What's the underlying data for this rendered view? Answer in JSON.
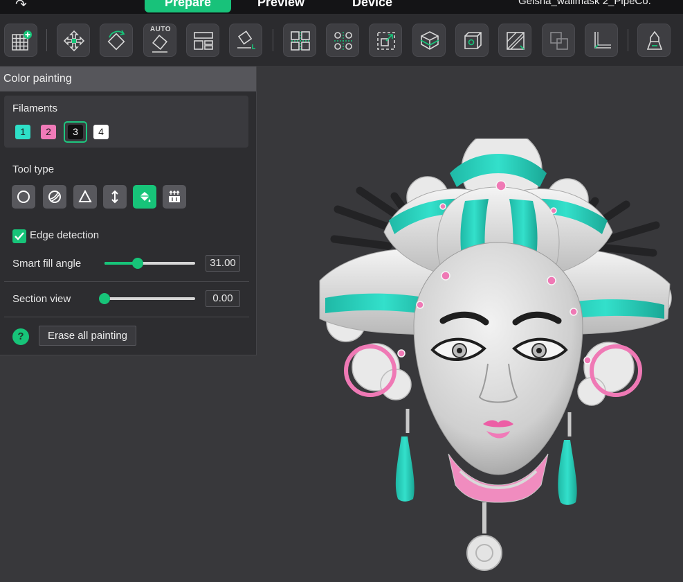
{
  "top_bar": {
    "redo_glyph": "↷",
    "tabs": [
      {
        "label": "Prepare",
        "active": true
      },
      {
        "label": "Preview",
        "active": false
      },
      {
        "label": "Device",
        "active": false
      }
    ],
    "project_title": "Geisha_wallmask 2_PipeCo."
  },
  "toolbar": {
    "auto_label": "AUTO",
    "buttons": [
      "add-plate-icon",
      "arrange-icon",
      "orient-icon",
      "auto-orient-icon",
      "layout-icon",
      "lay-on-face-icon",
      "split-objects-icon",
      "split-parts-icon",
      "bounding-box-icon",
      "slice-plane-icon",
      "cube-icon",
      "support-paint-icon",
      "boolean-icon",
      "measure-icon",
      "color-paint-icon"
    ]
  },
  "panel": {
    "title": "Color painting",
    "filaments_label": "Filaments",
    "filaments": [
      {
        "number": "1",
        "color": "#2ee0c8",
        "text_color": "#1a1a1a"
      },
      {
        "number": "2",
        "color": "#f07ab8",
        "text_color": "#1a1a1a"
      },
      {
        "number": "3",
        "color": "#111111",
        "text_color": "#ffffff",
        "selected": true
      },
      {
        "number": "4",
        "color": "#ffffff",
        "text_color": "#1a1a1a"
      }
    ],
    "tool_type_label": "Tool type",
    "tools": [
      {
        "name": "circle-tool-icon",
        "active": false
      },
      {
        "name": "sphere-tool-icon",
        "active": false
      },
      {
        "name": "triangle-tool-icon",
        "active": false
      },
      {
        "name": "height-range-tool-icon",
        "active": false
      },
      {
        "name": "fill-bucket-tool-icon",
        "active": true
      },
      {
        "name": "gap-fill-tool-icon",
        "active": false
      }
    ],
    "edge_detection_label": "Edge detection",
    "edge_detection_checked": true,
    "smart_fill_label": "Smart fill angle",
    "smart_fill_value": "31.00",
    "smart_fill_fraction": 0.37,
    "section_view_label": "Section view",
    "section_view_value": "0.00",
    "section_view_fraction": 0.0,
    "help_glyph": "?",
    "erase_label": "Erase all painting"
  },
  "colors": {
    "accent": "#17c479",
    "teal": "#22d3bd",
    "pink": "#f07ab8"
  }
}
